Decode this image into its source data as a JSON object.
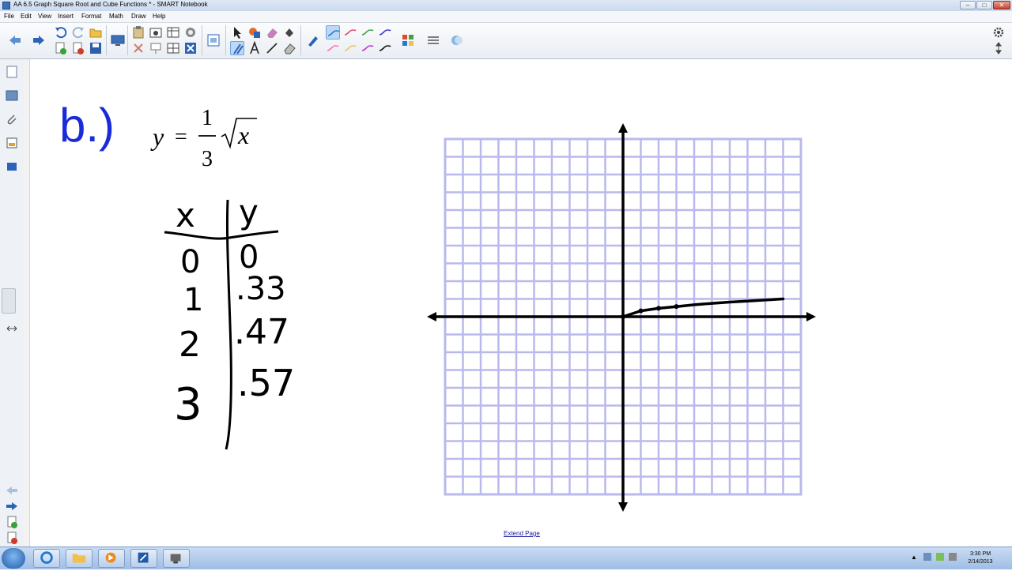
{
  "window": {
    "title": "AA 6.5 Graph Square Root and Cube Functions * - SMART Notebook",
    "minimize": "‒",
    "maximize": "□",
    "close": "✕"
  },
  "menu": [
    "File",
    "Edit",
    "View",
    "Insert",
    "Format",
    "Math",
    "Draw",
    "Help"
  ],
  "toolbar": {
    "icons": [
      "back-icon",
      "forward-icon",
      "undo-icon",
      "redo-icon",
      "open-icon",
      "add-page-icon",
      "delete-page-icon",
      "save-icon",
      "screen-shade-icon",
      "paste-icon",
      "capture-icon",
      "table-icon",
      "document-camera-icon",
      "cut-icon",
      "clear-icon",
      "table-insert-icon",
      "delete-icon",
      "select-icon",
      "shape-icon",
      "fill-icon",
      "eraser-icon",
      "pen-icon",
      "line-icon",
      "text-icon",
      "properties-icon"
    ],
    "pen_colors": [
      "#1f7bd6",
      "#e04a6a",
      "#43a047",
      "#3a3ad0",
      "#ff6fb0",
      "#e6c85a",
      "#c02fd0",
      "#111111"
    ]
  },
  "page": {
    "part_label": "b.)",
    "equation": {
      "y": "y",
      "equals": "=",
      "numerator": "1",
      "denominator": "3",
      "radicand": "x"
    },
    "table": {
      "headers": [
        "x",
        "y"
      ],
      "rows": [
        [
          "0",
          "0"
        ],
        [
          "1",
          ".33"
        ],
        [
          "2",
          ".47"
        ],
        [
          "3",
          ".57"
        ]
      ]
    },
    "extend_link": "Extend Page"
  },
  "chart_data": {
    "type": "line",
    "title": "",
    "xlabel": "",
    "ylabel": "",
    "grid": true,
    "xlim": [
      -10,
      10
    ],
    "ylim": [
      -10,
      10
    ],
    "series": [
      {
        "x": [
          0,
          1,
          2,
          3,
          4,
          5,
          6,
          7,
          8,
          9
        ],
        "y": [
          0,
          0.33,
          0.47,
          0.57,
          0.67,
          0.75,
          0.82,
          0.88,
          0.94,
          1.0
        ]
      }
    ]
  },
  "taskbar": {
    "apps": [
      "internet-explorer-icon",
      "file-explorer-icon",
      "media-player-icon",
      "smart-notebook-icon",
      "smart-tools-icon"
    ],
    "time": "3:30 PM",
    "date": "2/14/2013"
  }
}
